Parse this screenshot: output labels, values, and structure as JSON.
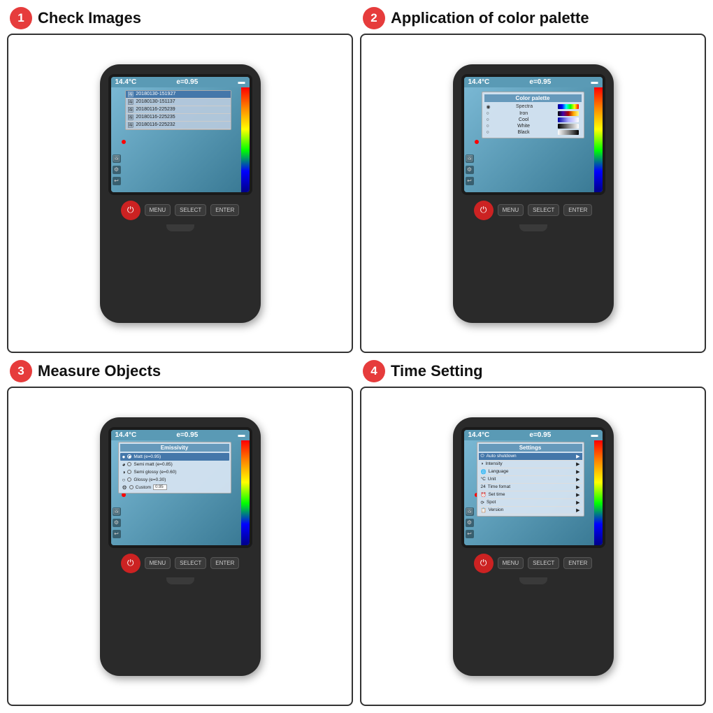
{
  "steps": [
    {
      "id": 1,
      "title": "Check Images",
      "badge": "❶",
      "screen": {
        "temp": "14.4°C",
        "emissivity": "e=0.95",
        "type": "file-list",
        "files": [
          {
            "name": "20180130-151927",
            "selected": true
          },
          {
            "name": "20180130-151137",
            "selected": false
          },
          {
            "name": "20180116-225239",
            "selected": false
          },
          {
            "name": "20180116-225235",
            "selected": false
          },
          {
            "name": "20180116-225232",
            "selected": false
          }
        ]
      },
      "buttons": [
        "MENU",
        "SELECT",
        "ENTER"
      ]
    },
    {
      "id": 2,
      "title": "Application of color palette",
      "badge": "❷",
      "screen": {
        "temp": "14.4°C",
        "emissivity": "e=0.95",
        "type": "color-palette",
        "palette_title": "Color palette",
        "items": [
          {
            "name": "Spectra",
            "selected": true,
            "swatch": "spectra"
          },
          {
            "name": "Iron",
            "selected": false,
            "swatch": "iron"
          },
          {
            "name": "Cool",
            "selected": false,
            "swatch": "cool"
          },
          {
            "name": "White",
            "selected": false,
            "swatch": "white"
          },
          {
            "name": "Black",
            "selected": false,
            "swatch": "black"
          }
        ]
      },
      "buttons": [
        "MENU",
        "SELECT",
        "ENTER"
      ]
    },
    {
      "id": 3,
      "title": "Measure Objects",
      "badge": "❸",
      "screen": {
        "temp": "14.4°C",
        "emissivity": "e=0.95",
        "type": "emissivity",
        "menu_title": "Emissivity",
        "items": [
          {
            "name": "Matt (e=0.95)",
            "selected": true,
            "icon": "●"
          },
          {
            "name": "Semi matt (e=0.85)",
            "selected": false,
            "icon": "◕"
          },
          {
            "name": "Semi glossy (e=0.60)",
            "selected": false,
            "icon": "◑"
          },
          {
            "name": "Glossy (e=0.30)",
            "selected": false,
            "icon": "○"
          },
          {
            "name": "Custom",
            "selected": false,
            "icon": "⚙",
            "value": "0.95"
          }
        ]
      },
      "buttons": [
        "MENU",
        "SELECT",
        "ENTER"
      ]
    },
    {
      "id": 4,
      "title": "Time Setting",
      "badge": "❹",
      "screen": {
        "temp": "14.4°C",
        "emissivity": "e=0.95",
        "type": "settings",
        "menu_title": "Settings",
        "items": [
          {
            "icon": "⏻",
            "name": "Auto shutdown",
            "selected": true
          },
          {
            "icon": "◑",
            "name": "Intensity",
            "selected": false
          },
          {
            "icon": "🌐",
            "name": "Language",
            "selected": false
          },
          {
            "icon": "°C",
            "name": "Unit",
            "selected": false
          },
          {
            "icon": "24",
            "name": "Time fomat",
            "selected": false
          },
          {
            "icon": "⏰",
            "name": "Set time",
            "selected": false
          },
          {
            "icon": "⟳",
            "name": "Spot",
            "selected": false
          },
          {
            "icon": "📋",
            "name": "Version",
            "selected": false
          }
        ]
      },
      "buttons": [
        "MENU",
        "SELECT",
        "ENTER"
      ]
    }
  ]
}
